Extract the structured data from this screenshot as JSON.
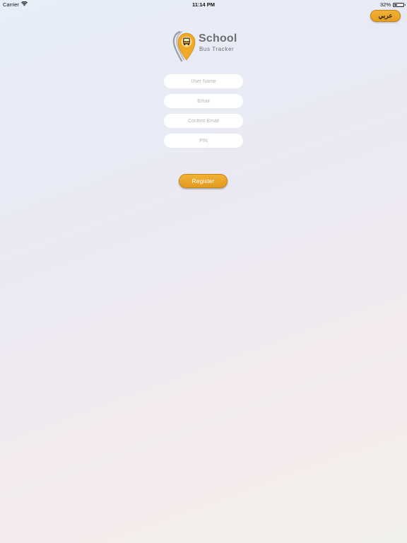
{
  "status_bar": {
    "carrier": "Carrier",
    "time": "11:14 PM",
    "battery_percent": "32%",
    "battery_level": 0.32,
    "wifi_icon": "wifi-icon",
    "battery_icon": "battery-icon"
  },
  "language_button": {
    "label": "عربي"
  },
  "logo": {
    "title": "School",
    "subtitle": "Bus  Tracker",
    "icon": "school-bus-location-pin-icon"
  },
  "form": {
    "fields": [
      {
        "name": "user-name",
        "placeholder": "User Name",
        "value": ""
      },
      {
        "name": "email",
        "placeholder": "Email",
        "value": ""
      },
      {
        "name": "confirm-email",
        "placeholder": "Confirm Email",
        "value": ""
      },
      {
        "name": "pin",
        "placeholder": "PIN",
        "value": ""
      }
    ],
    "register_label": "Register"
  },
  "colors": {
    "accent": "#e9a42a",
    "accent_border": "#c98414",
    "logo_text": "#6f6f72",
    "field_background": "#ffffff",
    "placeholder": "#b5b5b8"
  }
}
